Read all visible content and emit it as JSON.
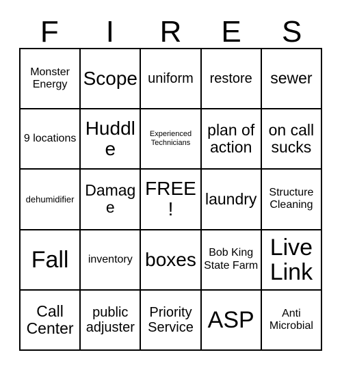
{
  "card": {
    "title": "FIRES Bingo Card",
    "header_letters": [
      "F",
      "I",
      "R",
      "E",
      "S"
    ],
    "grid_size": "5x5",
    "free_space": "FREE!",
    "colors": {
      "background": "#ffffff",
      "border": "#000000",
      "text": "#000000"
    },
    "cells": [
      {
        "text": "Monster Energy",
        "size": "md",
        "free": false
      },
      {
        "text": "Scope",
        "size": "xxl",
        "free": false
      },
      {
        "text": "uniform",
        "size": "lg",
        "free": false
      },
      {
        "text": "restore",
        "size": "lg",
        "free": false
      },
      {
        "text": "sewer",
        "size": "xl",
        "free": false
      },
      {
        "text": "9 locations",
        "size": "md",
        "free": false
      },
      {
        "text": "Huddle",
        "size": "xxl",
        "free": false
      },
      {
        "text": "Experienced Technicians",
        "size": "xs",
        "free": false
      },
      {
        "text": "plan of action",
        "size": "xl",
        "free": false
      },
      {
        "text": "on call sucks",
        "size": "xl",
        "free": false
      },
      {
        "text": "dehumidifier",
        "size": "sm",
        "free": false
      },
      {
        "text": "Damage",
        "size": "xl",
        "free": false
      },
      {
        "text": "FREE!",
        "size": "xxl",
        "free": true
      },
      {
        "text": "laundry",
        "size": "xl",
        "free": false
      },
      {
        "text": "Structure Cleaning",
        "size": "md",
        "free": false
      },
      {
        "text": "Fall",
        "size": "3xl",
        "free": false
      },
      {
        "text": "inventory",
        "size": "md",
        "free": false
      },
      {
        "text": "boxes",
        "size": "xxl",
        "free": false
      },
      {
        "text": "Bob King State Farm",
        "size": "md",
        "free": false
      },
      {
        "text": "Live Link",
        "size": "3xl",
        "free": false
      },
      {
        "text": "Call Center",
        "size": "xl",
        "free": false
      },
      {
        "text": "public adjuster",
        "size": "lg",
        "free": false
      },
      {
        "text": "Priority Service",
        "size": "lg",
        "free": false
      },
      {
        "text": "ASP",
        "size": "3xl",
        "free": false
      },
      {
        "text": "Anti Microbial",
        "size": "md",
        "free": false
      }
    ]
  }
}
